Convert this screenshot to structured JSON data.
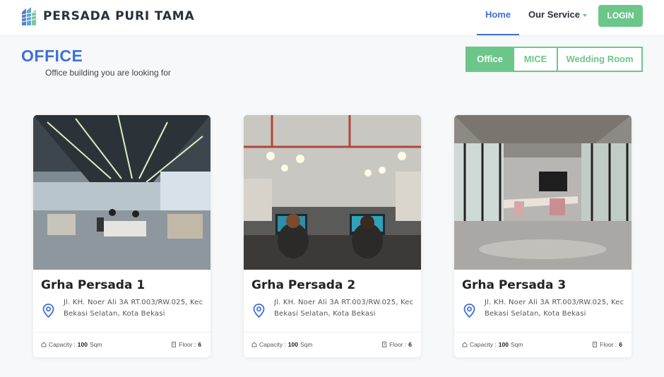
{
  "navbar": {
    "brand_icon": "building-stripes-icon",
    "brand_name": "PERSADA PURI TAMA",
    "home": "Home",
    "our_service": "Our Service",
    "login": "LOGIN"
  },
  "heading": {
    "title": "OFFICE",
    "subtitle": "Office building you are looking for"
  },
  "tabs": [
    {
      "label": "Office",
      "active": true
    },
    {
      "label": "MICE",
      "active": false
    },
    {
      "label": "Wedding Room",
      "active": false
    }
  ],
  "cards": [
    {
      "title": "Grha Persada 1",
      "address": "Jl. KH. Noer Ali 3A RT.003/RW.025, Kec Bekasi Selatan, Kota Bekasi",
      "capacity_label": "Capacity :",
      "capacity_value": "100",
      "capacity_unit": "Sqm",
      "floor_label": "Floor :",
      "floor_value": "6"
    },
    {
      "title": "Grha Persada 2",
      "address": "Jl. KH. Noer Ali 3A RT.003/RW.025, Kec Bekasi Selatan, Kota Bekasi",
      "capacity_label": "Capacity :",
      "capacity_value": "100",
      "capacity_unit": "Sqm",
      "floor_label": "Floor :",
      "floor_value": "6"
    },
    {
      "title": "Grha Persada 3",
      "address": "Jl. KH. Noer Ali 3A RT.003/RW.025, Kec Bekasi Selatan, Kota Bekasi",
      "capacity_label": "Capacity :",
      "capacity_value": "100",
      "capacity_unit": "Sqm",
      "floor_label": "Floor :",
      "floor_value": "6"
    }
  ],
  "colors": {
    "primary_blue": "#3f6fd8",
    "accent_green": "#6cc68a",
    "page_background": "#f7f8f9"
  }
}
